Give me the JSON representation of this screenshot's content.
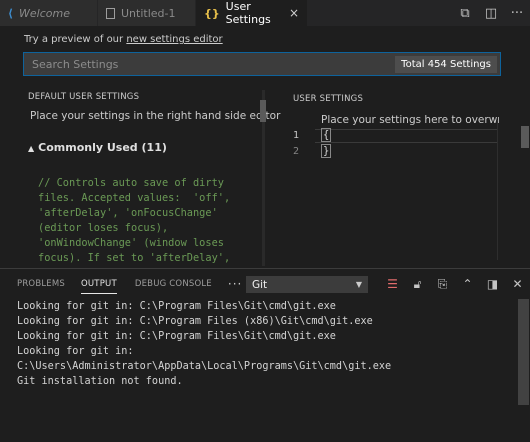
{
  "tabs": [
    {
      "label": "Welcome",
      "icon": "vscode-logo-icon"
    },
    {
      "label": "Untitled-1",
      "icon": "file-icon"
    },
    {
      "label": "User Settings",
      "icon": "json-braces-icon",
      "active": true
    }
  ],
  "tab_close": "×",
  "tab_actions": [
    {
      "name": "open-settings-json-icon",
      "glyph": "⧉"
    },
    {
      "name": "split-editor-icon",
      "glyph": "◫"
    },
    {
      "name": "more-actions-icon",
      "glyph": "···"
    }
  ],
  "preview": {
    "prefix": "Try a preview of our ",
    "link": "new settings editor"
  },
  "search": {
    "placeholder": "Search Settings",
    "value": "",
    "total": "Total 454 Settings"
  },
  "left": {
    "title": "DEFAULT USER SETTINGS",
    "description": "Place your settings in the right hand side editor",
    "section": "Commonly Used (11)",
    "comment_lines": [
      "// Controls auto save of dirty",
      "files. Accepted values:  'off',",
      "'afterDelay', 'onFocusChange'",
      "(editor loses focus),",
      "'onWindowChange' (window loses",
      "focus). If set to 'afterDelay',"
    ]
  },
  "right": {
    "title": "USER SETTINGS",
    "hint": "Place your settings here to overwrite",
    "line_numbers": [
      "1",
      "2"
    ],
    "code_lines": [
      "{",
      "}"
    ]
  },
  "panel": {
    "tabs": [
      "PROBLEMS",
      "OUTPUT",
      "DEBUG CONSOLE"
    ],
    "active_tab": "OUTPUT",
    "more": "···",
    "channel": "Git",
    "output_lines": [
      "Looking for git in: C:\\Program Files\\Git\\cmd\\git.exe",
      "Looking for git in: C:\\Program Files (x86)\\Git\\cmd\\git.exe",
      "Looking for git in: C:\\Program Files\\Git\\cmd\\git.exe",
      "Looking for git in:",
      "C:\\Users\\Administrator\\AppData\\Local\\Programs\\Git\\cmd\\git.exe",
      "Git installation not found."
    ]
  }
}
